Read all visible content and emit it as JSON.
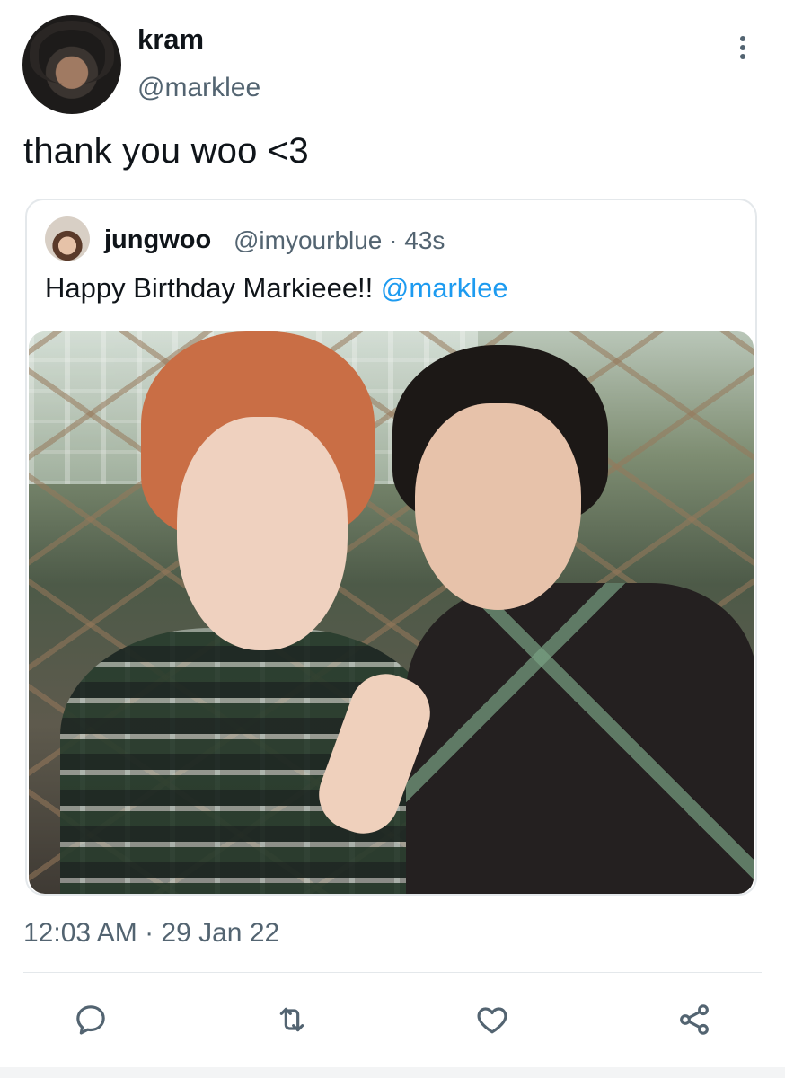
{
  "tweet": {
    "author": {
      "display_name": "kram",
      "handle": "@marklee"
    },
    "text": "thank you woo <3",
    "timestamp": "12:03 AM · 29 Jan 22",
    "menu_icon": "more-vertical-icon"
  },
  "quoted_tweet": {
    "author": {
      "display_name": "jungwoo",
      "handle": "@imyourblue · 43s"
    },
    "text": "Happy Birthday Markieee!! ",
    "mention": "@marklee"
  },
  "actions": [
    {
      "icon": "reply-icon"
    },
    {
      "icon": "retweet-icon"
    },
    {
      "icon": "like-icon"
    },
    {
      "icon": "share-icon"
    }
  ],
  "colors": {
    "text_primary": "#0f1419",
    "text_secondary": "#536471",
    "link": "#1d9bf0",
    "border": "#e4e8eb"
  }
}
